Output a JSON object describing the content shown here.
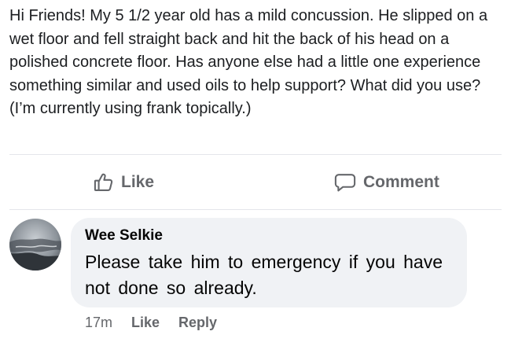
{
  "post": {
    "text": "Hi Friends! My 5 1/2 year old has a mild concussion. He slipped on a wet floor and fell straight back and hit the back of his head on a polished concrete floor. Has anyone else had a little one experience something similar and used oils to help support? What did you use? (I’m currently using frank topically.)"
  },
  "actions": {
    "like_label": "Like",
    "comment_label": "Comment",
    "like_icon": "thumbs-up-icon",
    "comment_icon": "speech-bubble-icon"
  },
  "comment": {
    "author": "Wee Selkie",
    "text": "Please take him to emergency if you have not done so already.",
    "time": "17m",
    "like_label": "Like",
    "reply_label": "Reply"
  },
  "colors": {
    "text_primary": "#050505",
    "text_secondary": "#65676b",
    "bubble_bg": "#f0f2f5",
    "divider": "#e4e6eb"
  }
}
